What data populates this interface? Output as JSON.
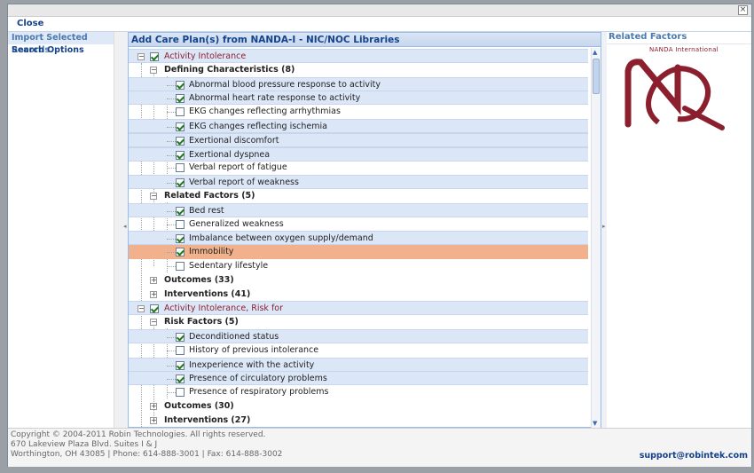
{
  "toolbar": {
    "close_label": "Close"
  },
  "left_panel": {
    "items": [
      {
        "label": "Import Selected Records",
        "active": true
      },
      {
        "label": "Search Options",
        "active": false
      }
    ]
  },
  "center_panel": {
    "title": "Add Care Plan(s) from NANDA-I - NIC/NOC Libraries"
  },
  "right_panel": {
    "title": "Related Factors",
    "logo_text": "NANDA International"
  },
  "tree": [
    {
      "type": "diagnosis",
      "label": "Activity Intolerance",
      "checked": true
    },
    {
      "type": "group",
      "label": "Defining Characteristics (8)",
      "expanded": true
    },
    {
      "type": "leaf",
      "label": "Abnormal blood pressure response to activity",
      "checked": true
    },
    {
      "type": "leaf",
      "label": "Abnormal heart rate response to activity",
      "checked": true
    },
    {
      "type": "leaf",
      "label": "EKG changes reflecting arrhythmias",
      "checked": false
    },
    {
      "type": "leaf",
      "label": "EKG changes reflecting ischemia",
      "checked": true
    },
    {
      "type": "leaf",
      "label": "Exertional discomfort",
      "checked": true
    },
    {
      "type": "leaf",
      "label": "Exertional dyspnea",
      "checked": true
    },
    {
      "type": "leaf",
      "label": "Verbal report of fatigue",
      "checked": false
    },
    {
      "type": "leaf",
      "label": "Verbal report of weakness",
      "checked": true
    },
    {
      "type": "group",
      "label": "Related Factors (5)",
      "expanded": true
    },
    {
      "type": "leaf",
      "label": "Bed rest",
      "checked": true
    },
    {
      "type": "leaf",
      "label": "Generalized weakness",
      "checked": false
    },
    {
      "type": "leaf",
      "label": "Imbalance between oxygen supply/demand",
      "checked": true
    },
    {
      "type": "leaf",
      "label": "Immobility",
      "checked": true,
      "selected": true
    },
    {
      "type": "leaf",
      "label": "Sedentary lifestyle",
      "checked": false
    },
    {
      "type": "group",
      "label": "Outcomes (33)",
      "expanded": false
    },
    {
      "type": "group",
      "label": "Interventions (41)",
      "expanded": false
    },
    {
      "type": "diagnosis",
      "label": "Activity Intolerance, Risk for",
      "checked": true
    },
    {
      "type": "group",
      "label": "Risk Factors (5)",
      "expanded": true
    },
    {
      "type": "leaf",
      "label": "Deconditioned status",
      "checked": true
    },
    {
      "type": "leaf",
      "label": "History of previous intolerance",
      "checked": false
    },
    {
      "type": "leaf",
      "label": "Inexperience with the activity",
      "checked": true
    },
    {
      "type": "leaf",
      "label": "Presence of circulatory problems",
      "checked": true
    },
    {
      "type": "leaf",
      "label": "Presence of respiratory problems",
      "checked": false
    },
    {
      "type": "group",
      "label": "Outcomes (30)",
      "expanded": false
    },
    {
      "type": "group",
      "label": "Interventions (27)",
      "expanded": false
    }
  ],
  "footer": {
    "copyright": "Copyright © 2004-2011 Robin Technologies. All rights reserved.",
    "address": "670 Lakeview Plaza Blvd. Suites I & J",
    "contact": "Worthington, OH 43085 | Phone: 614-888-3001 | Fax: 614-888-3002",
    "support": "support@robintek.com"
  },
  "colors": {
    "accent": "#15428b",
    "diagnosis_text": "#8b1f2d",
    "selected_row": "#f0b18c",
    "highlight_row": "#dbe7f7"
  }
}
